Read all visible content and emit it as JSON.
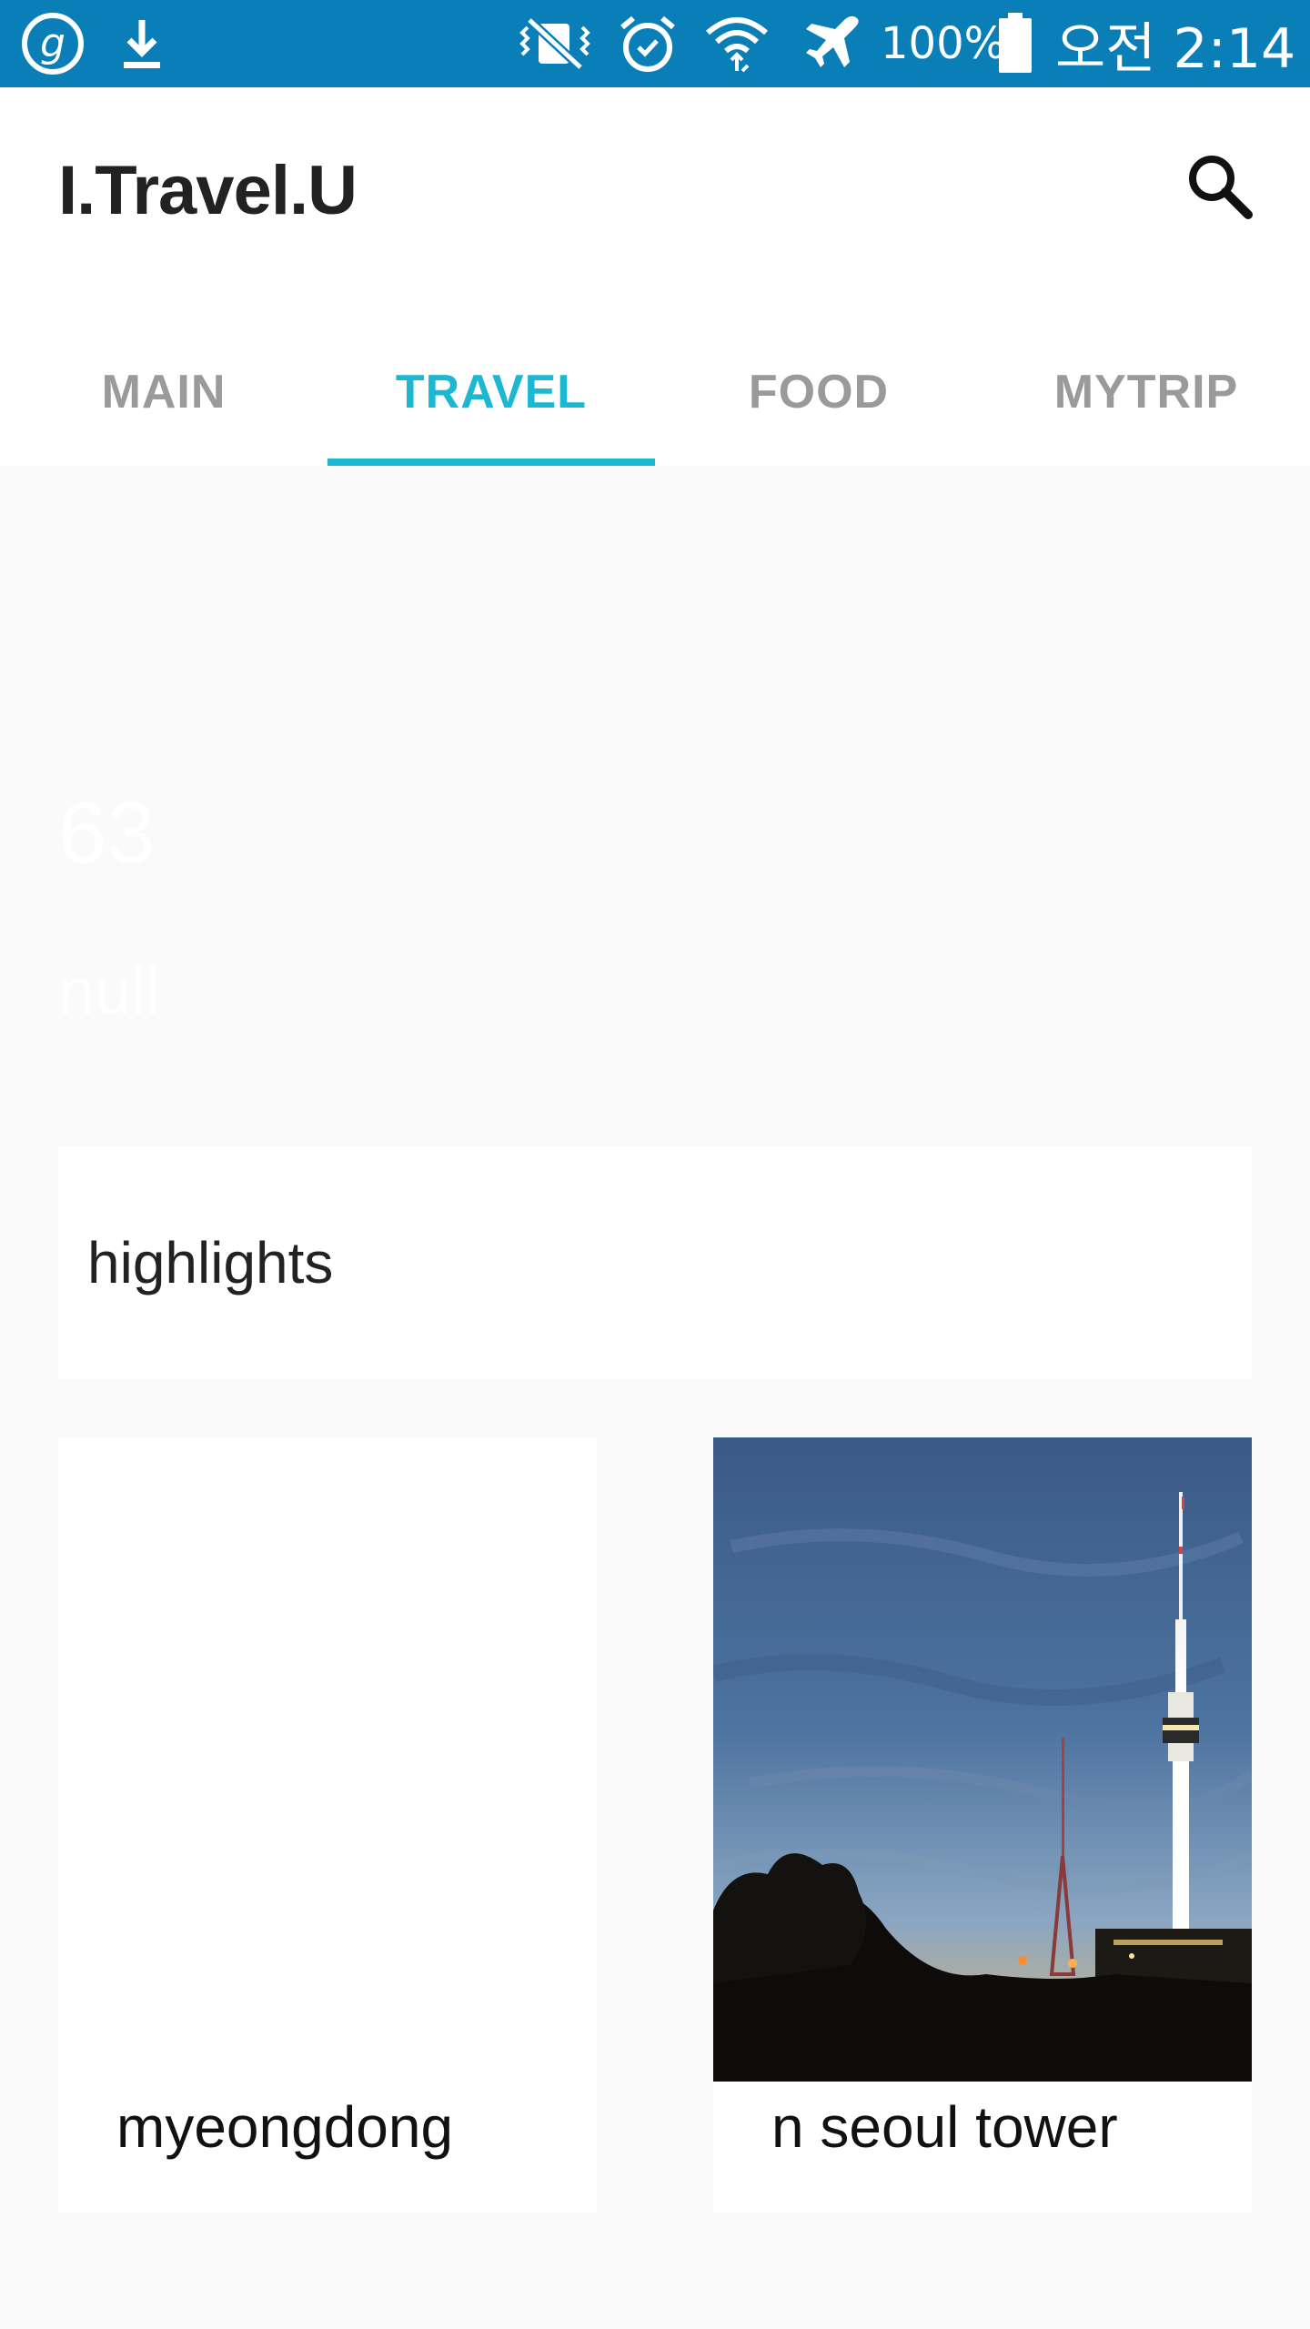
{
  "status_bar": {
    "battery": "100%",
    "time": "오전 2:14",
    "icons": [
      "app-g-icon",
      "download-icon",
      "vibrate-mute-icon",
      "alarm-icon",
      "wifi-icon",
      "airplane-icon",
      "battery-icon"
    ]
  },
  "app": {
    "title": "I.Travel.U"
  },
  "tabs": [
    {
      "label": "MAIN",
      "active": false
    },
    {
      "label": "TRAVEL",
      "active": true
    },
    {
      "label": "FOOD",
      "active": false
    },
    {
      "label": "MYTRIP",
      "active": false
    }
  ],
  "header_block": {
    "number": "63",
    "subtitle": "null"
  },
  "highlights": {
    "label": "highlights"
  },
  "places": [
    {
      "name": "myeongdong",
      "has_image": false
    },
    {
      "name": "n seoul tower",
      "has_image": true
    }
  ],
  "colors": {
    "status_bar": "#0a7fb7",
    "accent": "#1cb8d2",
    "tab_inactive": "#9a9a9a",
    "background": "#fafafa"
  }
}
